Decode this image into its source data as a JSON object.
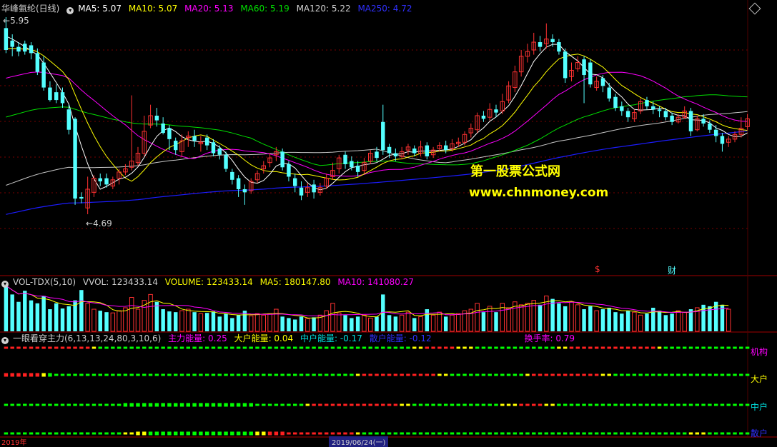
{
  "header": {
    "stock_title": "华峰氨纶(日线)",
    "ma5": "MA5: 5.07",
    "ma10": "MA10: 5.07",
    "ma20": "MA20: 5.13",
    "ma60": "MA60: 5.19",
    "ma120": "MA120: 5.22",
    "ma250": "MA250: 4.72"
  },
  "main": {
    "high_label": "5.95",
    "low_label": "4.69",
    "watermark_title": "第一股票公式网",
    "watermark_url": "www.chnmoney.com",
    "event_marker_1": "$",
    "event_marker_2": "财"
  },
  "volume": {
    "name": "VOL-TDX(5,10)",
    "vvol": "VVOL: 123433.14",
    "volume": "VOLUME: 123433.14",
    "ma5": "MA5: 180147.80",
    "ma10": "MA10: 141080.27"
  },
  "indicator": {
    "name": "一眼看穿主力(6,13,13,24,80,3,10,6)",
    "main_energy": "主力能量: 0.25",
    "big_energy": "大户能量: 0.04",
    "mid_energy": "中户能量: -0.17",
    "retail_energy": "散户能量: -0.12",
    "turnover": "换手率: 0.79",
    "row_labels": [
      "机构",
      "大户",
      "中户",
      "散户"
    ]
  },
  "bottom_axis": {
    "year_label": "2019年",
    "date_label": "2019/06/24(一)"
  },
  "colors": {
    "up": "#ff3232",
    "down": "#54ffff",
    "ma5": "#ffffff",
    "ma10": "#ffff00",
    "ma20": "#ff00ff",
    "ma60": "#00e000",
    "ma120": "#c8c8c8",
    "ma250": "#1c1cff"
  },
  "chart_data": {
    "type": "candlestick",
    "y_range": [
      4.69,
      5.95
    ],
    "candles": [
      {
        "o": 5.88,
        "c": 5.74,
        "h": 5.95,
        "l": 5.72
      },
      {
        "o": 5.8,
        "c": 5.76,
        "h": 5.84,
        "l": 5.7
      },
      {
        "o": 5.76,
        "c": 5.73,
        "h": 5.79,
        "l": 5.7
      },
      {
        "o": 5.78,
        "c": 5.73,
        "h": 5.8,
        "l": 5.71
      },
      {
        "o": 5.77,
        "c": 5.72,
        "h": 5.79,
        "l": 5.68
      },
      {
        "o": 5.72,
        "c": 5.6,
        "h": 5.75,
        "l": 5.58
      },
      {
        "o": 5.66,
        "c": 5.5,
        "h": 5.7,
        "l": 5.48
      },
      {
        "o": 5.5,
        "c": 5.42,
        "h": 5.54,
        "l": 5.41
      },
      {
        "o": 5.47,
        "c": 5.42,
        "h": 5.52,
        "l": 5.4
      },
      {
        "o": 5.47,
        "c": 5.4,
        "h": 5.5,
        "l": 5.37
      },
      {
        "o": 5.36,
        "c": 5.23,
        "h": 5.39,
        "l": 5.2
      },
      {
        "o": 5.3,
        "c": 4.79,
        "h": 5.31,
        "l": 4.75
      },
      {
        "o": 4.8,
        "c": 4.79,
        "h": 4.83,
        "l": 4.76
      },
      {
        "o": 4.73,
        "c": 4.85,
        "h": 4.93,
        "l": 4.69
      },
      {
        "o": 4.83,
        "c": 4.92,
        "h": 4.94,
        "l": 4.8
      },
      {
        "o": 4.92,
        "c": 4.9,
        "h": 4.95,
        "l": 4.87
      },
      {
        "o": 4.92,
        "c": 4.88,
        "h": 4.95,
        "l": 4.86
      },
      {
        "o": 4.87,
        "c": 4.91,
        "h": 4.93,
        "l": 4.85
      },
      {
        "o": 4.92,
        "c": 4.96,
        "h": 4.98,
        "l": 4.88
      },
      {
        "o": 4.96,
        "c": 4.98,
        "h": 5.01,
        "l": 4.94
      },
      {
        "o": 4.99,
        "c": 5.03,
        "h": 5.45,
        "l": 4.97
      },
      {
        "o": 5.02,
        "c": 5.08,
        "h": 5.12,
        "l": 5.0
      },
      {
        "o": 5.08,
        "c": 5.22,
        "h": 5.32,
        "l": 5.06
      },
      {
        "o": 5.26,
        "c": 5.32,
        "h": 5.39,
        "l": 5.24
      },
      {
        "o": 5.32,
        "c": 5.29,
        "h": 5.37,
        "l": 5.25
      },
      {
        "o": 5.27,
        "c": 5.21,
        "h": 5.31,
        "l": 5.2
      },
      {
        "o": 5.24,
        "c": 5.17,
        "h": 5.26,
        "l": 5.1
      },
      {
        "o": 5.16,
        "c": 5.1,
        "h": 5.18,
        "l": 5.07
      },
      {
        "o": 5.09,
        "c": 5.16,
        "h": 5.2,
        "l": 5.06
      },
      {
        "o": 5.18,
        "c": 5.19,
        "h": 5.22,
        "l": 5.12
      },
      {
        "o": 5.19,
        "c": 5.16,
        "h": 5.23,
        "l": 5.12
      },
      {
        "o": 5.14,
        "c": 5.15,
        "h": 5.19,
        "l": 5.09
      },
      {
        "o": 5.18,
        "c": 5.13,
        "h": 5.2,
        "l": 5.1
      },
      {
        "o": 5.15,
        "c": 5.08,
        "h": 5.17,
        "l": 5.06
      },
      {
        "o": 5.11,
        "c": 5.07,
        "h": 5.13,
        "l": 5.04
      },
      {
        "o": 5.07,
        "c": 4.98,
        "h": 5.09,
        "l": 4.96
      },
      {
        "o": 4.96,
        "c": 4.91,
        "h": 4.98,
        "l": 4.88
      },
      {
        "o": 4.92,
        "c": 4.85,
        "h": 4.94,
        "l": 4.8
      },
      {
        "o": 4.85,
        "c": 4.83,
        "h": 4.88,
        "l": 4.75
      },
      {
        "o": 4.84,
        "c": 4.9,
        "h": 4.92,
        "l": 4.82
      },
      {
        "o": 4.91,
        "c": 4.95,
        "h": 4.97,
        "l": 4.89
      },
      {
        "o": 4.98,
        "c": 5.0,
        "h": 5.03,
        "l": 4.95
      },
      {
        "o": 5.02,
        "c": 5.05,
        "h": 5.08,
        "l": 4.99
      },
      {
        "o": 5.07,
        "c": 5.09,
        "h": 5.12,
        "l": 5.03
      },
      {
        "o": 5.09,
        "c": 4.99,
        "h": 5.11,
        "l": 4.97
      },
      {
        "o": 5.01,
        "c": 4.93,
        "h": 5.03,
        "l": 4.9
      },
      {
        "o": 4.92,
        "c": 4.87,
        "h": 4.95,
        "l": 4.83
      },
      {
        "o": 4.86,
        "c": 4.81,
        "h": 4.9,
        "l": 4.78
      },
      {
        "o": 4.83,
        "c": 4.86,
        "h": 4.89,
        "l": 4.8
      },
      {
        "o": 4.88,
        "c": 4.83,
        "h": 4.91,
        "l": 4.79
      },
      {
        "o": 4.83,
        "c": 4.86,
        "h": 4.89,
        "l": 4.81
      },
      {
        "o": 4.87,
        "c": 4.92,
        "h": 4.95,
        "l": 4.85
      },
      {
        "o": 4.93,
        "c": 4.97,
        "h": 5.02,
        "l": 4.91
      },
      {
        "o": 4.98,
        "c": 5.05,
        "h": 5.07,
        "l": 4.95
      },
      {
        "o": 5.07,
        "c": 5.01,
        "h": 5.09,
        "l": 4.98
      },
      {
        "o": 5.03,
        "c": 4.99,
        "h": 5.06,
        "l": 4.97
      },
      {
        "o": 5.0,
        "c": 4.96,
        "h": 5.03,
        "l": 4.93
      },
      {
        "o": 4.97,
        "c": 5.02,
        "h": 5.05,
        "l": 4.95
      },
      {
        "o": 5.03,
        "c": 5.08,
        "h": 5.1,
        "l": 5.01
      },
      {
        "o": 5.09,
        "c": 5.05,
        "h": 5.12,
        "l": 5.03
      },
      {
        "o": 5.28,
        "c": 5.1,
        "h": 5.39,
        "l": 5.07
      },
      {
        "o": 5.12,
        "c": 5.08,
        "h": 5.14,
        "l": 5.05
      },
      {
        "o": 5.08,
        "c": 5.06,
        "h": 5.11,
        "l": 5.03
      },
      {
        "o": 5.06,
        "c": 5.09,
        "h": 5.12,
        "l": 5.04
      },
      {
        "o": 5.1,
        "c": 5.12,
        "h": 5.14,
        "l": 5.07
      },
      {
        "o": 5.11,
        "c": 5.08,
        "h": 5.13,
        "l": 5.06
      },
      {
        "o": 5.08,
        "c": 5.12,
        "h": 5.16,
        "l": 5.06
      },
      {
        "o": 5.13,
        "c": 5.06,
        "h": 5.15,
        "l": 5.04
      },
      {
        "o": 5.07,
        "c": 5.1,
        "h": 5.12,
        "l": 5.05
      },
      {
        "o": 5.11,
        "c": 5.13,
        "h": 5.15,
        "l": 5.09
      },
      {
        "o": 5.13,
        "c": 5.1,
        "h": 5.16,
        "l": 5.08
      },
      {
        "o": 5.11,
        "c": 5.14,
        "h": 5.17,
        "l": 5.09
      },
      {
        "o": 5.14,
        "c": 5.15,
        "h": 5.18,
        "l": 5.12
      },
      {
        "o": 5.15,
        "c": 5.2,
        "h": 5.22,
        "l": 5.13
      },
      {
        "o": 5.21,
        "c": 5.24,
        "h": 5.27,
        "l": 5.18
      },
      {
        "o": 5.23,
        "c": 5.32,
        "h": 5.34,
        "l": 5.21
      },
      {
        "o": 5.32,
        "c": 5.3,
        "h": 5.35,
        "l": 5.28
      },
      {
        "o": 5.31,
        "c": 5.36,
        "h": 5.4,
        "l": 5.29
      },
      {
        "o": 5.36,
        "c": 5.34,
        "h": 5.39,
        "l": 5.31
      },
      {
        "o": 5.35,
        "c": 5.41,
        "h": 5.46,
        "l": 5.33
      },
      {
        "o": 5.42,
        "c": 5.51,
        "h": 5.54,
        "l": 5.4
      },
      {
        "o": 5.5,
        "c": 5.6,
        "h": 5.64,
        "l": 5.47
      },
      {
        "o": 5.6,
        "c": 5.7,
        "h": 5.74,
        "l": 5.57
      },
      {
        "o": 5.7,
        "c": 5.73,
        "h": 5.78,
        "l": 5.66
      },
      {
        "o": 5.74,
        "c": 5.79,
        "h": 5.85,
        "l": 5.71
      },
      {
        "o": 5.79,
        "c": 5.76,
        "h": 5.83,
        "l": 5.73
      },
      {
        "o": 5.78,
        "c": 5.81,
        "h": 5.91,
        "l": 5.75
      },
      {
        "o": 5.81,
        "c": 5.79,
        "h": 5.84,
        "l": 5.76
      },
      {
        "o": 5.79,
        "c": 5.73,
        "h": 5.81,
        "l": 5.71
      },
      {
        "o": 5.73,
        "c": 5.56,
        "h": 5.75,
        "l": 5.53
      },
      {
        "o": 5.57,
        "c": 5.61,
        "h": 5.66,
        "l": 5.54
      },
      {
        "o": 5.62,
        "c": 5.66,
        "h": 5.7,
        "l": 5.6
      },
      {
        "o": 5.68,
        "c": 5.58,
        "h": 5.7,
        "l": 5.4
      },
      {
        "o": 5.66,
        "c": 5.52,
        "h": 5.68,
        "l": 5.5
      },
      {
        "o": 5.5,
        "c": 5.54,
        "h": 5.57,
        "l": 5.48
      },
      {
        "o": 5.56,
        "c": 5.51,
        "h": 5.58,
        "l": 5.47
      },
      {
        "o": 5.5,
        "c": 5.43,
        "h": 5.53,
        "l": 5.41
      },
      {
        "o": 5.44,
        "c": 5.37,
        "h": 5.46,
        "l": 5.35
      },
      {
        "o": 5.38,
        "c": 5.35,
        "h": 5.41,
        "l": 5.32
      },
      {
        "o": 5.35,
        "c": 5.31,
        "h": 5.37,
        "l": 5.28
      },
      {
        "o": 5.3,
        "c": 5.34,
        "h": 5.36,
        "l": 5.28
      },
      {
        "o": 5.35,
        "c": 5.41,
        "h": 5.43,
        "l": 5.33
      },
      {
        "o": 5.42,
        "c": 5.38,
        "h": 5.44,
        "l": 5.36
      },
      {
        "o": 5.38,
        "c": 5.36,
        "h": 5.41,
        "l": 5.33
      },
      {
        "o": 5.36,
        "c": 5.35,
        "h": 5.38,
        "l": 5.31
      },
      {
        "o": 5.35,
        "c": 5.31,
        "h": 5.37,
        "l": 5.29
      },
      {
        "o": 5.32,
        "c": 5.28,
        "h": 5.34,
        "l": 5.26
      },
      {
        "o": 5.28,
        "c": 5.31,
        "h": 5.33,
        "l": 5.27
      },
      {
        "o": 5.31,
        "c": 5.35,
        "h": 5.38,
        "l": 5.3
      },
      {
        "o": 5.35,
        "c": 5.22,
        "h": 5.37,
        "l": 5.19
      },
      {
        "o": 5.23,
        "c": 5.3,
        "h": 5.32,
        "l": 5.22
      },
      {
        "o": 5.3,
        "c": 5.27,
        "h": 5.33,
        "l": 5.25
      },
      {
        "o": 5.27,
        "c": 5.23,
        "h": 5.29,
        "l": 5.21
      },
      {
        "o": 5.23,
        "c": 5.19,
        "h": 5.26,
        "l": 5.15
      },
      {
        "o": 5.19,
        "c": 5.14,
        "h": 5.21,
        "l": 5.09
      },
      {
        "o": 5.15,
        "c": 5.17,
        "h": 5.19,
        "l": 5.12
      },
      {
        "o": 5.17,
        "c": 5.2,
        "h": 5.22,
        "l": 5.15
      },
      {
        "o": 5.2,
        "c": 5.24,
        "h": 5.31,
        "l": 5.18
      },
      {
        "o": 5.25,
        "c": 5.3,
        "h": 5.33,
        "l": 5.23
      }
    ],
    "volume": [
      62,
      50,
      40,
      55,
      42,
      38,
      48,
      30,
      38,
      31,
      34,
      42,
      56,
      38,
      30,
      28,
      26,
      25,
      28,
      32,
      46,
      30,
      42,
      50,
      40,
      30,
      27,
      26,
      28,
      30,
      26,
      24,
      25,
      27,
      20,
      24,
      18,
      22,
      28,
      21,
      24,
      22,
      24,
      30,
      20,
      18,
      16,
      20,
      17,
      19,
      22,
      28,
      38,
      25,
      22,
      18,
      20,
      22,
      18,
      20,
      50,
      22,
      20,
      22,
      26,
      18,
      20,
      30,
      22,
      26,
      20,
      22,
      24,
      28,
      30,
      38,
      26,
      34,
      26,
      38,
      32,
      40,
      36,
      38,
      42,
      36,
      48,
      44,
      38,
      34,
      40,
      36,
      30,
      34,
      28,
      30,
      32,
      26,
      24,
      28,
      26,
      22,
      24,
      32,
      28,
      22,
      24,
      28,
      26,
      30,
      32,
      36,
      34,
      40,
      36,
      30
    ],
    "vol_max": 62
  }
}
